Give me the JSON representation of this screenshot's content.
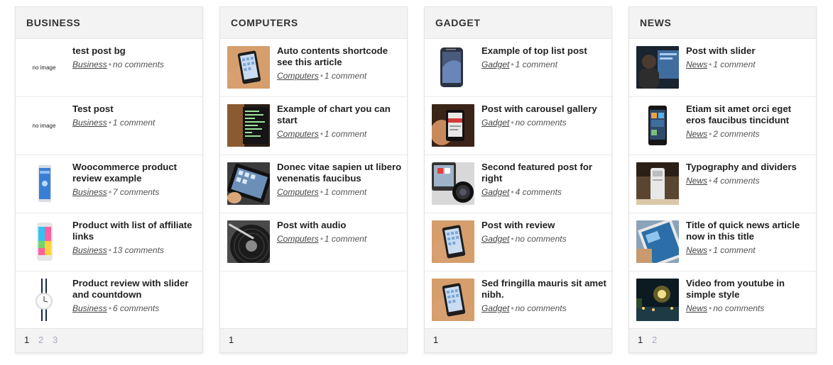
{
  "widgets": [
    {
      "title": "BUSINESS",
      "items": [
        {
          "title": "test post bg",
          "category": "Business",
          "comments": "no comments",
          "thumb": "noimg"
        },
        {
          "title": "Test post",
          "category": "Business",
          "comments": "1 comment",
          "thumb": "noimg"
        },
        {
          "title": "Woocommerce product review example",
          "category": "Business",
          "comments": "7 comments",
          "thumb": "phone-blue"
        },
        {
          "title": "Product with list of affiliate links",
          "category": "Business",
          "comments": "13 comments",
          "thumb": "phone-colorful"
        },
        {
          "title": "Product review with slider and countdown",
          "category": "Business",
          "comments": "6 comments",
          "thumb": "watch"
        }
      ],
      "pages": [
        "1",
        "2",
        "3"
      ]
    },
    {
      "title": "COMPUTERS",
      "items": [
        {
          "title": "Auto contents shortcode see this article",
          "category": "Computers",
          "comments": "1 comment",
          "thumb": "hand-phone"
        },
        {
          "title": "Example of chart you can start",
          "category": "Computers",
          "comments": "1 comment",
          "thumb": "code-screen"
        },
        {
          "title": "Donec vitae sapien ut libero venenatis faucibus",
          "category": "Computers",
          "comments": "1 comment",
          "thumb": "tablet-hand"
        },
        {
          "title": "Post with audio",
          "category": "Computers",
          "comments": "1 comment",
          "thumb": "vinyl"
        }
      ],
      "pages": [
        "1"
      ]
    },
    {
      "title": "GADGET",
      "items": [
        {
          "title": "Example of top list post",
          "category": "Gadget",
          "comments": "1 comment",
          "thumb": "phone-dark"
        },
        {
          "title": "Post with carousel gallery",
          "category": "Gadget",
          "comments": "no comments",
          "thumb": "hand-phone-red"
        },
        {
          "title": "Second featured post for right",
          "category": "Gadget",
          "comments": "4 comments",
          "thumb": "camera-lens"
        },
        {
          "title": "Post with review",
          "category": "Gadget",
          "comments": "no comments",
          "thumb": "hand-phone"
        },
        {
          "title": "Sed fringilla mauris sit amet nibh.",
          "category": "Gadget",
          "comments": "no comments",
          "thumb": "hand-phone"
        }
      ],
      "pages": [
        "1"
      ]
    },
    {
      "title": "NEWS",
      "items": [
        {
          "title": "Post with slider",
          "category": "News",
          "comments": "1 comment",
          "thumb": "person-screen"
        },
        {
          "title": "Etiam sit amet orci eget eros faucibus tincidunt",
          "category": "News",
          "comments": "2 comments",
          "thumb": "phone-black"
        },
        {
          "title": "Typography and dividers",
          "category": "News",
          "comments": "4 comments",
          "thumb": "mac-pro"
        },
        {
          "title": "Title of quick news article now in this title",
          "category": "News",
          "comments": "1 comment",
          "thumb": "tablet-blue"
        },
        {
          "title": "Video from youtube in simple style",
          "category": "News",
          "comments": "no comments",
          "thumb": "night-garden"
        }
      ],
      "pages": [
        "1",
        "2"
      ]
    }
  ],
  "no_image_label": "no image",
  "meta_separator": "•",
  "colors": {
    "header_bg": "#f3f3f3",
    "active_page": "#222222",
    "inactive_page": "#a8abc6"
  }
}
